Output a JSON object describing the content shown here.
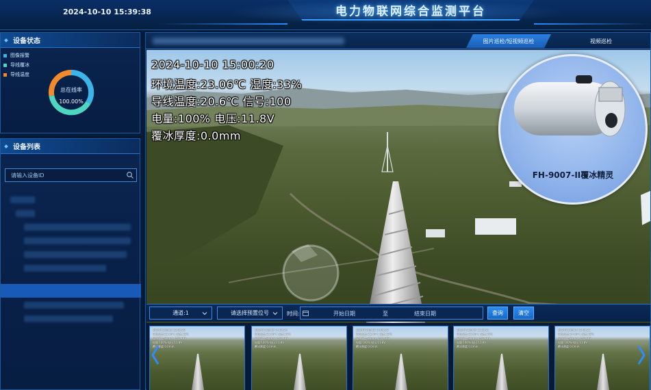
{
  "header": {
    "datetime": "2024-10-10 15:39:38",
    "title": "电力物联网综合监测平台"
  },
  "status_panel": {
    "title": "设备状态",
    "legend": [
      {
        "label": "图像报警",
        "color": "#3bb5e8"
      },
      {
        "label": "导线覆冰",
        "color": "#4fd6c1"
      },
      {
        "label": "导线温度",
        "color": "#f28a2d"
      }
    ],
    "donut": {
      "label": "总在线率",
      "value_text": "100.00%",
      "online_fraction": 1.0,
      "colors": [
        "#f28a2d",
        "#3bb5e8",
        "#4fd6c1"
      ]
    }
  },
  "device_list": {
    "title": "设备列表",
    "search_placeholder": "请输入设备ID"
  },
  "main": {
    "tabs": [
      {
        "label": "图片巡检/短视频巡检",
        "active": true
      },
      {
        "label": "视频巡检",
        "active": false
      }
    ],
    "osd": [
      "2024-10-10 15:00:20",
      "环境温度:23.06℃ 湿度:33%",
      "导线温度:20.6℃ 信号:100",
      "电量:100% 电压:11.8V",
      "覆冰厚度:0.0mm"
    ],
    "product_label": "FH-9007-II覆冰精灵",
    "filters": {
      "channel": "通道:1",
      "preset_placeholder": "请选择预置位号",
      "time_label": "时间:",
      "start_placeholder": "开始日期",
      "to_label": "至",
      "end_placeholder": "结束日期",
      "query_button": "查询",
      "clear_button": "清空"
    },
    "thumbnails": [
      {
        "lines": [
          "2024年10月10 15:00:20",
          "环境温度:23.06℃ 湿度:33%",
          "导线温度:20.6℃ 信号:100",
          "电量:100% 电压:11.8V",
          "覆冰厚度:0.0mm"
        ]
      },
      {
        "lines": [
          "2024年10月10 14:30:20",
          "环境温度:23.06℃ 湿度:33%",
          "导线温度:20.6℃ 信号:100",
          "电量:100% 电压:11.8V",
          "覆冰厚度:0.0mm"
        ]
      },
      {
        "lines": [
          "2024年10月10 14:00:20",
          "环境温度:23.06℃ 湿度:33%",
          "导线温度:20.6℃ 信号:100",
          "电量:100% 电压:11.8V",
          "覆冰厚度:0.0mm"
        ]
      },
      {
        "lines": [
          "2024年10月10 13:30:21",
          "环境温度:23.06℃ 湿度:33%",
          "导线温度:20.6℃ 信号:100",
          "电量:100% 电压:11.8V",
          "覆冰厚度:0.0mm"
        ]
      },
      {
        "lines": [
          "2024年10月10 13:00:22",
          "环境温度:24.06℃ 湿度:29%",
          "导线温度:20.6℃ 信号:100",
          "电量:100% 电压:11.8V",
          "覆冰厚度:0.0mm"
        ]
      }
    ]
  }
}
